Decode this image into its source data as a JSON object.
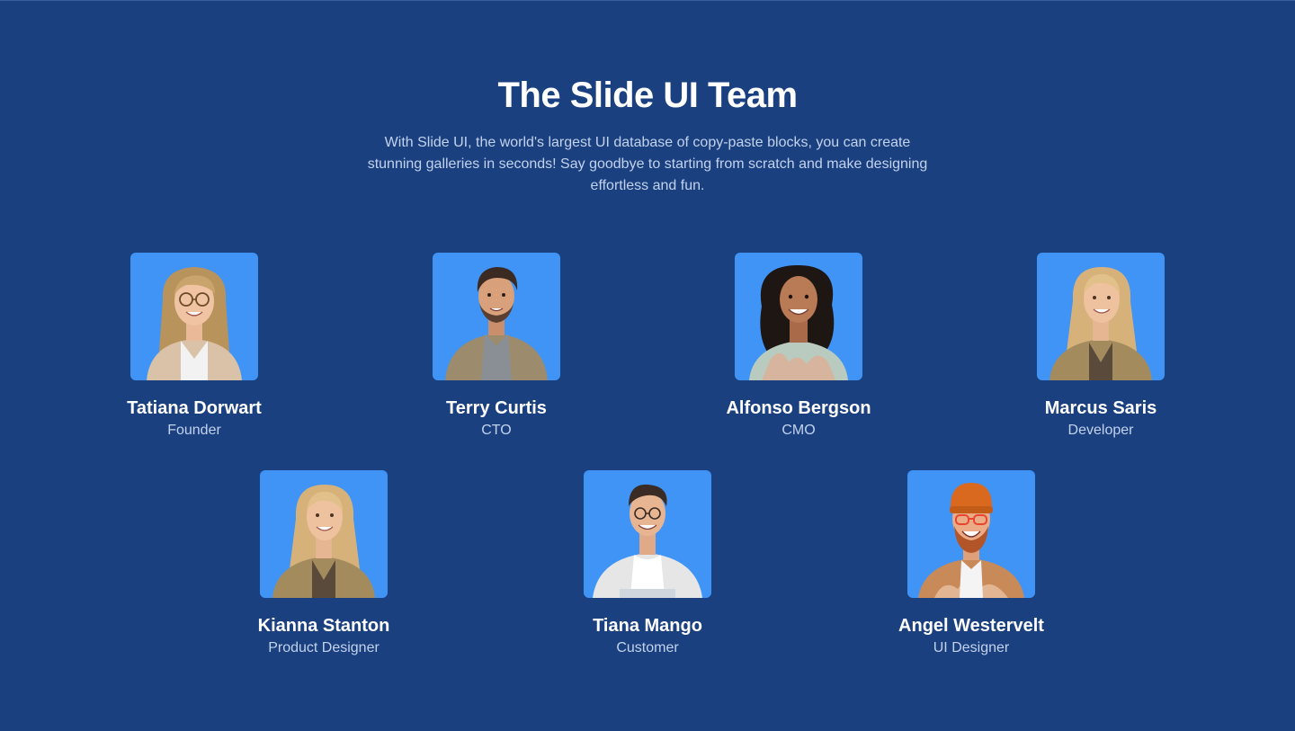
{
  "header": {
    "title": "The Slide UI Team",
    "description": "With Slide UI, the world's largest UI database of copy-paste blocks, you can create stunning galleries in seconds! Say goodbye to starting from scratch and make designing effortless and fun."
  },
  "team": [
    {
      "name": "Tatiana Dorwart",
      "role": "Founder",
      "avatar": "woman-glasses-portrait"
    },
    {
      "name": "Terry Curtis",
      "role": "CTO",
      "avatar": "man-beard-portrait"
    },
    {
      "name": "Alfonso Bergson",
      "role": "CMO",
      "avatar": "woman-curly-hair-portrait"
    },
    {
      "name": "Marcus Saris",
      "role": "Developer",
      "avatar": "woman-blonde-portrait"
    },
    {
      "name": "Kianna Stanton",
      "role": "Product Designer",
      "avatar": "woman-blonde-portrait"
    },
    {
      "name": "Tiana Mango",
      "role": "Customer",
      "avatar": "man-glasses-portrait"
    },
    {
      "name": "Angel Westervelt",
      "role": "UI Designer",
      "avatar": "man-beanie-glasses-portrait"
    }
  ],
  "colors": {
    "background": "#1a4080",
    "photo_background": "#3f94f6",
    "heading": "#ffffff",
    "muted_text": "#c3d2ec"
  }
}
